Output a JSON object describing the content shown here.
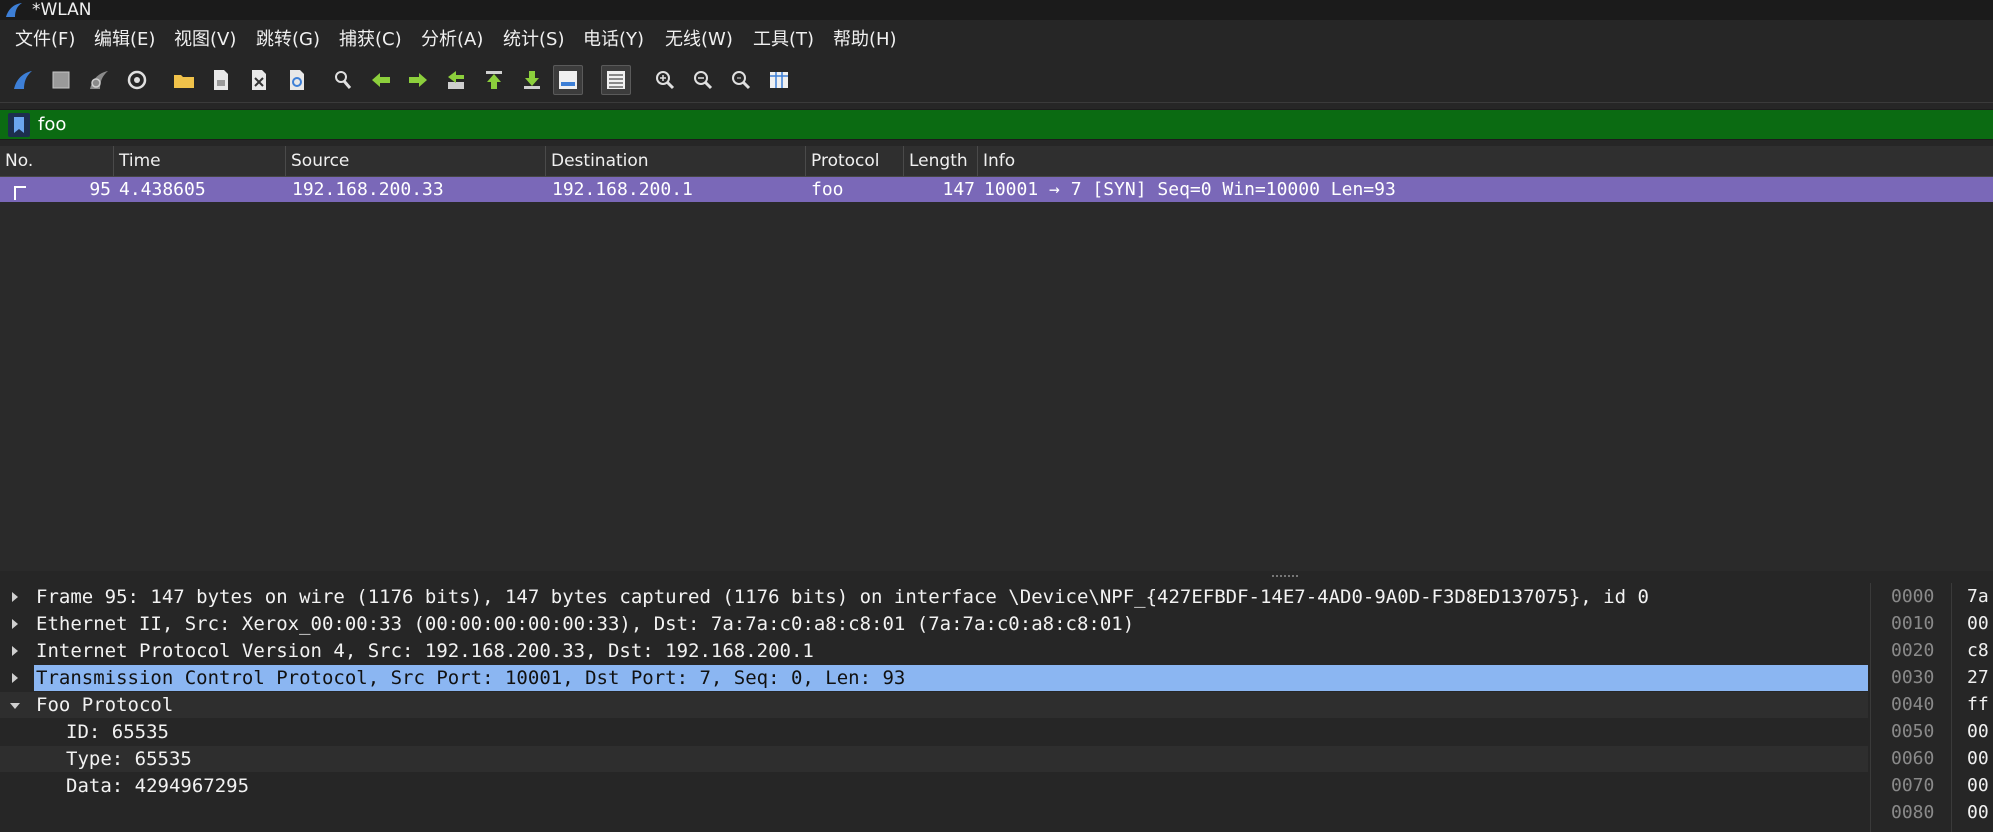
{
  "window": {
    "title": "*WLAN"
  },
  "menu": [
    "文件(F)",
    "编辑(E)",
    "视图(V)",
    "跳转(G)",
    "捕获(C)",
    "分析(A)",
    "统计(S)",
    "电话(Y)",
    "无线(W)",
    "工具(T)",
    "帮助(H)"
  ],
  "toolbar": {
    "icons": [
      "start-capture-icon",
      "stop-capture-icon",
      "restart-capture-icon",
      "capture-options-icon",
      "open-file-icon",
      "save-file-icon",
      "close-file-icon",
      "reload-file-icon",
      "find-packet-icon",
      "go-back-icon",
      "go-forward-icon",
      "go-to-packet-icon",
      "first-packet-icon",
      "last-packet-icon",
      "auto-scroll-icon",
      "colorize-icon",
      "zoom-in-icon",
      "zoom-out-icon",
      "normal-size-icon",
      "resize-columns-icon"
    ]
  },
  "filter": {
    "value": "foo"
  },
  "packet_list": {
    "columns": [
      "No.",
      "Time",
      "Source",
      "Destination",
      "Protocol",
      "Length",
      "Info"
    ],
    "rows": [
      {
        "no": "95",
        "time": "4.438605",
        "source": "192.168.200.33",
        "destination": "192.168.200.1",
        "protocol": "foo",
        "length": "147",
        "info": "10001 → 7 [SYN] Seq=0 Win=10000 Len=93"
      }
    ]
  },
  "details": {
    "frame": "Frame 95: 147 bytes on wire (1176 bits), 147 bytes captured (1176 bits) on interface \\Device\\NPF_{427EFBDF-14E7-4AD0-9A0D-F3D8ED137075}, id 0",
    "ethernet": "Ethernet II, Src: Xerox_00:00:33 (00:00:00:00:00:33), Dst: 7a:7a:c0:a8:c8:01 (7a:7a:c0:a8:c8:01)",
    "ip": "Internet Protocol Version 4, Src: 192.168.200.33, Dst: 192.168.200.1",
    "tcp": "Transmission Control Protocol, Src Port: 10001, Dst Port: 7, Seq: 0, Len: 93",
    "foo": "Foo Protocol",
    "foo_fields": [
      "ID: 65535",
      "Type: 65535",
      "Data: 4294967295"
    ]
  },
  "bytes": {
    "offsets": [
      "0000",
      "0010",
      "0020",
      "0030",
      "0040",
      "0050",
      "0060",
      "0070",
      "0080"
    ],
    "hex": [
      "7a",
      "00",
      "c8",
      "27",
      "ff",
      "00",
      "00",
      "00",
      "00"
    ]
  },
  "colors": {
    "filter_valid": "#0b6b12",
    "packet_row": "#7a68b8",
    "selected_detail": "#8bb6f2"
  }
}
